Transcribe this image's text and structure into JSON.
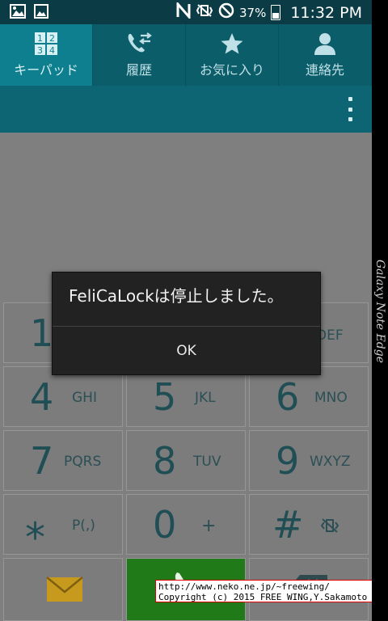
{
  "status_bar": {
    "battery": "37%",
    "time": "11:32 PM"
  },
  "tabs": [
    {
      "label": "キーパッド",
      "icon": "keypad-icon",
      "active": true
    },
    {
      "label": "履歴",
      "icon": "call-log-icon",
      "active": false
    },
    {
      "label": "お気に入り",
      "icon": "star-icon",
      "active": false
    },
    {
      "label": "連絡先",
      "icon": "person-icon",
      "active": false
    }
  ],
  "keypad_icon_digits": [
    "1",
    "2",
    "3",
    "4"
  ],
  "keys": [
    {
      "digit": "1",
      "letters": ""
    },
    {
      "digit": "",
      "letters": ""
    },
    {
      "digit": "",
      "letters": "DEF"
    },
    {
      "digit": "4",
      "letters": "GHI"
    },
    {
      "digit": "5",
      "letters": "JKL"
    },
    {
      "digit": "6",
      "letters": "MNO"
    },
    {
      "digit": "7",
      "letters": "PQRS"
    },
    {
      "digit": "8",
      "letters": "TUV"
    },
    {
      "digit": "9",
      "letters": "WXYZ"
    },
    {
      "digit": "⁎",
      "letters": "P(,)"
    },
    {
      "digit": "0",
      "letters": "+"
    },
    {
      "digit": "#",
      "letters": ""
    }
  ],
  "dialog": {
    "message": "FeliCaLockは停止しました。",
    "button": "OK"
  },
  "device_label": "Galaxy Note Edge",
  "watermark": {
    "line1": "http://www.neko.ne.jp/~freewing/",
    "line2": "Copyright (c) 2015 FREE WING,Y.Sakamoto"
  },
  "colors": {
    "status_bar": "#0b3b44",
    "tab_bar": "#0b5d6a",
    "tab_active": "#0e7f8f",
    "action_bar": "#0d6573",
    "call_button": "#1f7a17",
    "dialog_bg": "#222222"
  }
}
